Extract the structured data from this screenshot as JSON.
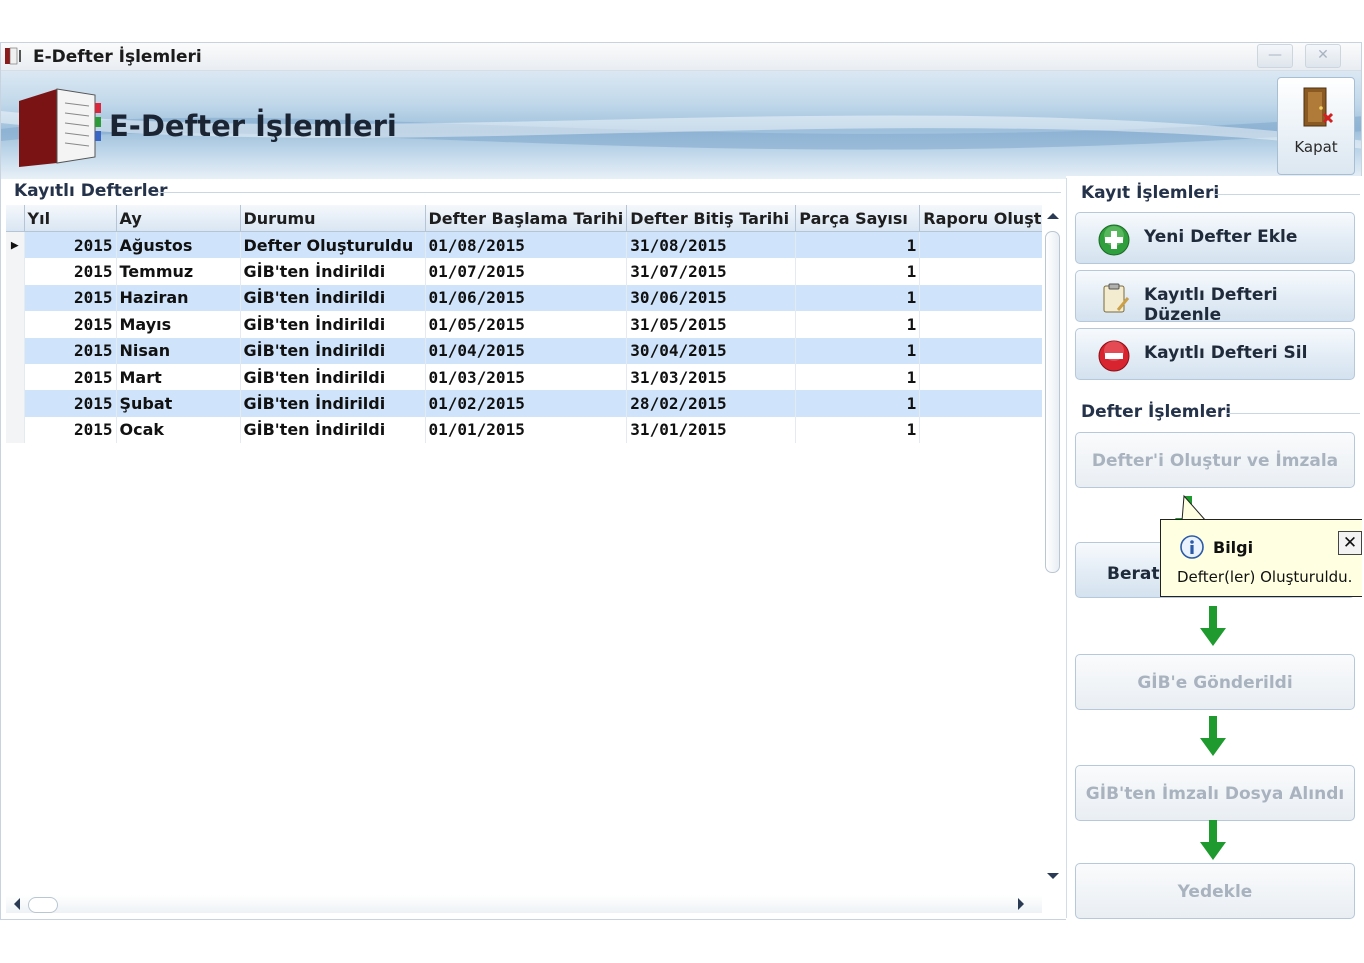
{
  "window": {
    "title": "E-Defter İşlemleri",
    "minimize_glyph": "—",
    "close_glyph": "✕"
  },
  "banner": {
    "title": "E-Defter İşlemleri",
    "close_button": "Kapat",
    "icon": "ledger-book-icon",
    "close_icon": "door-exit-icon"
  },
  "ledgers": {
    "group_title": "Kayıtlı Defterler",
    "columns": [
      "Yıl",
      "Ay",
      "Durumu",
      "Defter Başlama Tarihi",
      "Defter Bitiş Tarihi",
      "Parça Sayısı",
      "Raporu Oluştı"
    ],
    "rows": [
      {
        "yil": "2015",
        "ay": "Ağustos",
        "durum": "Defter Oluşturuldu",
        "baslama": "01/08/2015",
        "bitis": "31/08/2015",
        "parca": "1",
        "rapor": ""
      },
      {
        "yil": "2015",
        "ay": "Temmuz",
        "durum": "GİB'ten İndirildi",
        "baslama": "01/07/2015",
        "bitis": "31/07/2015",
        "parca": "1",
        "rapor": ""
      },
      {
        "yil": "2015",
        "ay": "Haziran",
        "durum": "GİB'ten İndirildi",
        "baslama": "01/06/2015",
        "bitis": "30/06/2015",
        "parca": "1",
        "rapor": ""
      },
      {
        "yil": "2015",
        "ay": "Mayıs",
        "durum": "GİB'ten İndirildi",
        "baslama": "01/05/2015",
        "bitis": "31/05/2015",
        "parca": "1",
        "rapor": ""
      },
      {
        "yil": "2015",
        "ay": "Nisan",
        "durum": "GİB'ten İndirildi",
        "baslama": "01/04/2015",
        "bitis": "30/04/2015",
        "parca": "1",
        "rapor": ""
      },
      {
        "yil": "2015",
        "ay": "Mart",
        "durum": "GİB'ten İndirildi",
        "baslama": "01/03/2015",
        "bitis": "31/03/2015",
        "parca": "1",
        "rapor": ""
      },
      {
        "yil": "2015",
        "ay": "Şubat",
        "durum": "GİB'ten İndirildi",
        "baslama": "01/02/2015",
        "bitis": "28/02/2015",
        "parca": "1",
        "rapor": ""
      },
      {
        "yil": "2015",
        "ay": "Ocak",
        "durum": "GİB'ten İndirildi",
        "baslama": "01/01/2015",
        "bitis": "31/01/2015",
        "parca": "1",
        "rapor": ""
      }
    ],
    "selected_row_indicator": "▶"
  },
  "record_ops": {
    "group_title": "Kayıt İşlemleri",
    "add_label": "Yeni Defter Ekle",
    "edit_label": "Kayıtlı Defteri Düzenle",
    "delete_label": "Kayıtlı Defteri Sil"
  },
  "ledger_ops": {
    "group_title": "Defter İşlemleri",
    "create_sign_label": "Defter'i Oluştur ve İmzala",
    "berat_label": "Berat'ı",
    "sent_label": "GİB'e Gönderildi",
    "received_label": "GİB'ten İmzalı Dosya Alındı",
    "backup_label": "Yedekle"
  },
  "tooltip": {
    "title": "Bilgi",
    "message": "Defter(ler) Oluşturuldu.",
    "close_glyph": "✕"
  },
  "colors": {
    "row_alt": "#cfe4fb",
    "arrow_green": "#1e9a2e",
    "disabled_text": "#a8b3bf"
  }
}
